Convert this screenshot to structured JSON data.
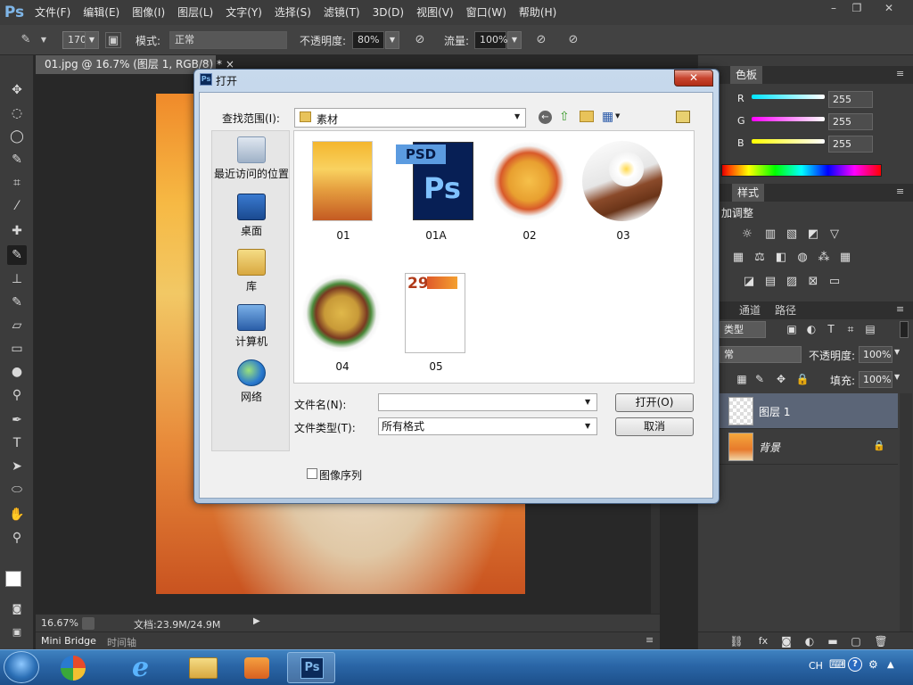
{
  "app": {
    "logo": "Ps",
    "menu": [
      "文件(F)",
      "编辑(E)",
      "图像(I)",
      "图层(L)",
      "文字(Y)",
      "选择(S)",
      "滤镜(T)",
      "3D(D)",
      "视图(V)",
      "窗口(W)",
      "帮助(H)"
    ],
    "window_controls": [
      "–",
      "❐",
      "✕"
    ]
  },
  "options_bar": {
    "brush_size": "170",
    "mode_label": "模式:",
    "mode_value": "正常",
    "opacity_label": "不透明度:",
    "opacity_value": "80%",
    "flow_label": "流量:",
    "flow_value": "100%"
  },
  "document": {
    "tab_title": "01.jpg @ 16.7% (图层 1, RGB/8) * ×",
    "zoom": "16.67%",
    "doc_size": "文档:23.9M/24.9M"
  },
  "bottom_tabs": [
    "Mini Bridge",
    "时间轴"
  ],
  "color_panel": {
    "tabs": [
      "色板"
    ],
    "channels": [
      {
        "label": "R",
        "value": "255",
        "color": "#00e5ff"
      },
      {
        "label": "G",
        "value": "255",
        "color": "#ff00ff"
      },
      {
        "label": "B",
        "value": "255",
        "color": "#ffff00"
      }
    ]
  },
  "adjustments_panel": {
    "tabs": [
      "样式"
    ],
    "title": "加调整"
  },
  "layers_panel": {
    "tabs": [
      "通道",
      "路径"
    ],
    "filter_label": "类型",
    "blend_mode": "常",
    "opacity_label": "不透明度:",
    "opacity_value": "100%",
    "fill_label": "填充:",
    "fill_value": "100%",
    "layers": [
      {
        "name": "图层 1",
        "selected": true
      },
      {
        "name": "背景",
        "selected": false,
        "locked": true
      }
    ]
  },
  "dialog": {
    "title": "打开",
    "close": "✕",
    "look_in_label": "查找范围(I):",
    "look_in_value": "素材",
    "places": [
      "最近访问的位置",
      "桌面",
      "库",
      "计算机",
      "网络"
    ],
    "files": [
      {
        "name": "01",
        "kind": "photo"
      },
      {
        "name": "01A",
        "kind": "psd",
        "badge": "PSD",
        "mark": "Ps"
      },
      {
        "name": "02",
        "kind": "food"
      },
      {
        "name": "03",
        "kind": "food"
      },
      {
        "name": "04",
        "kind": "food"
      },
      {
        "name": "05",
        "kind": "doc",
        "mark": "29"
      }
    ],
    "filename_label": "文件名(N):",
    "filename_value": "",
    "filetype_label": "文件类型(T):",
    "filetype_value": "所有格式",
    "open_button": "打开(O)",
    "cancel_button": "取消",
    "image_sequence_label": "图像序列"
  },
  "taskbar": {
    "lang": "CH"
  }
}
